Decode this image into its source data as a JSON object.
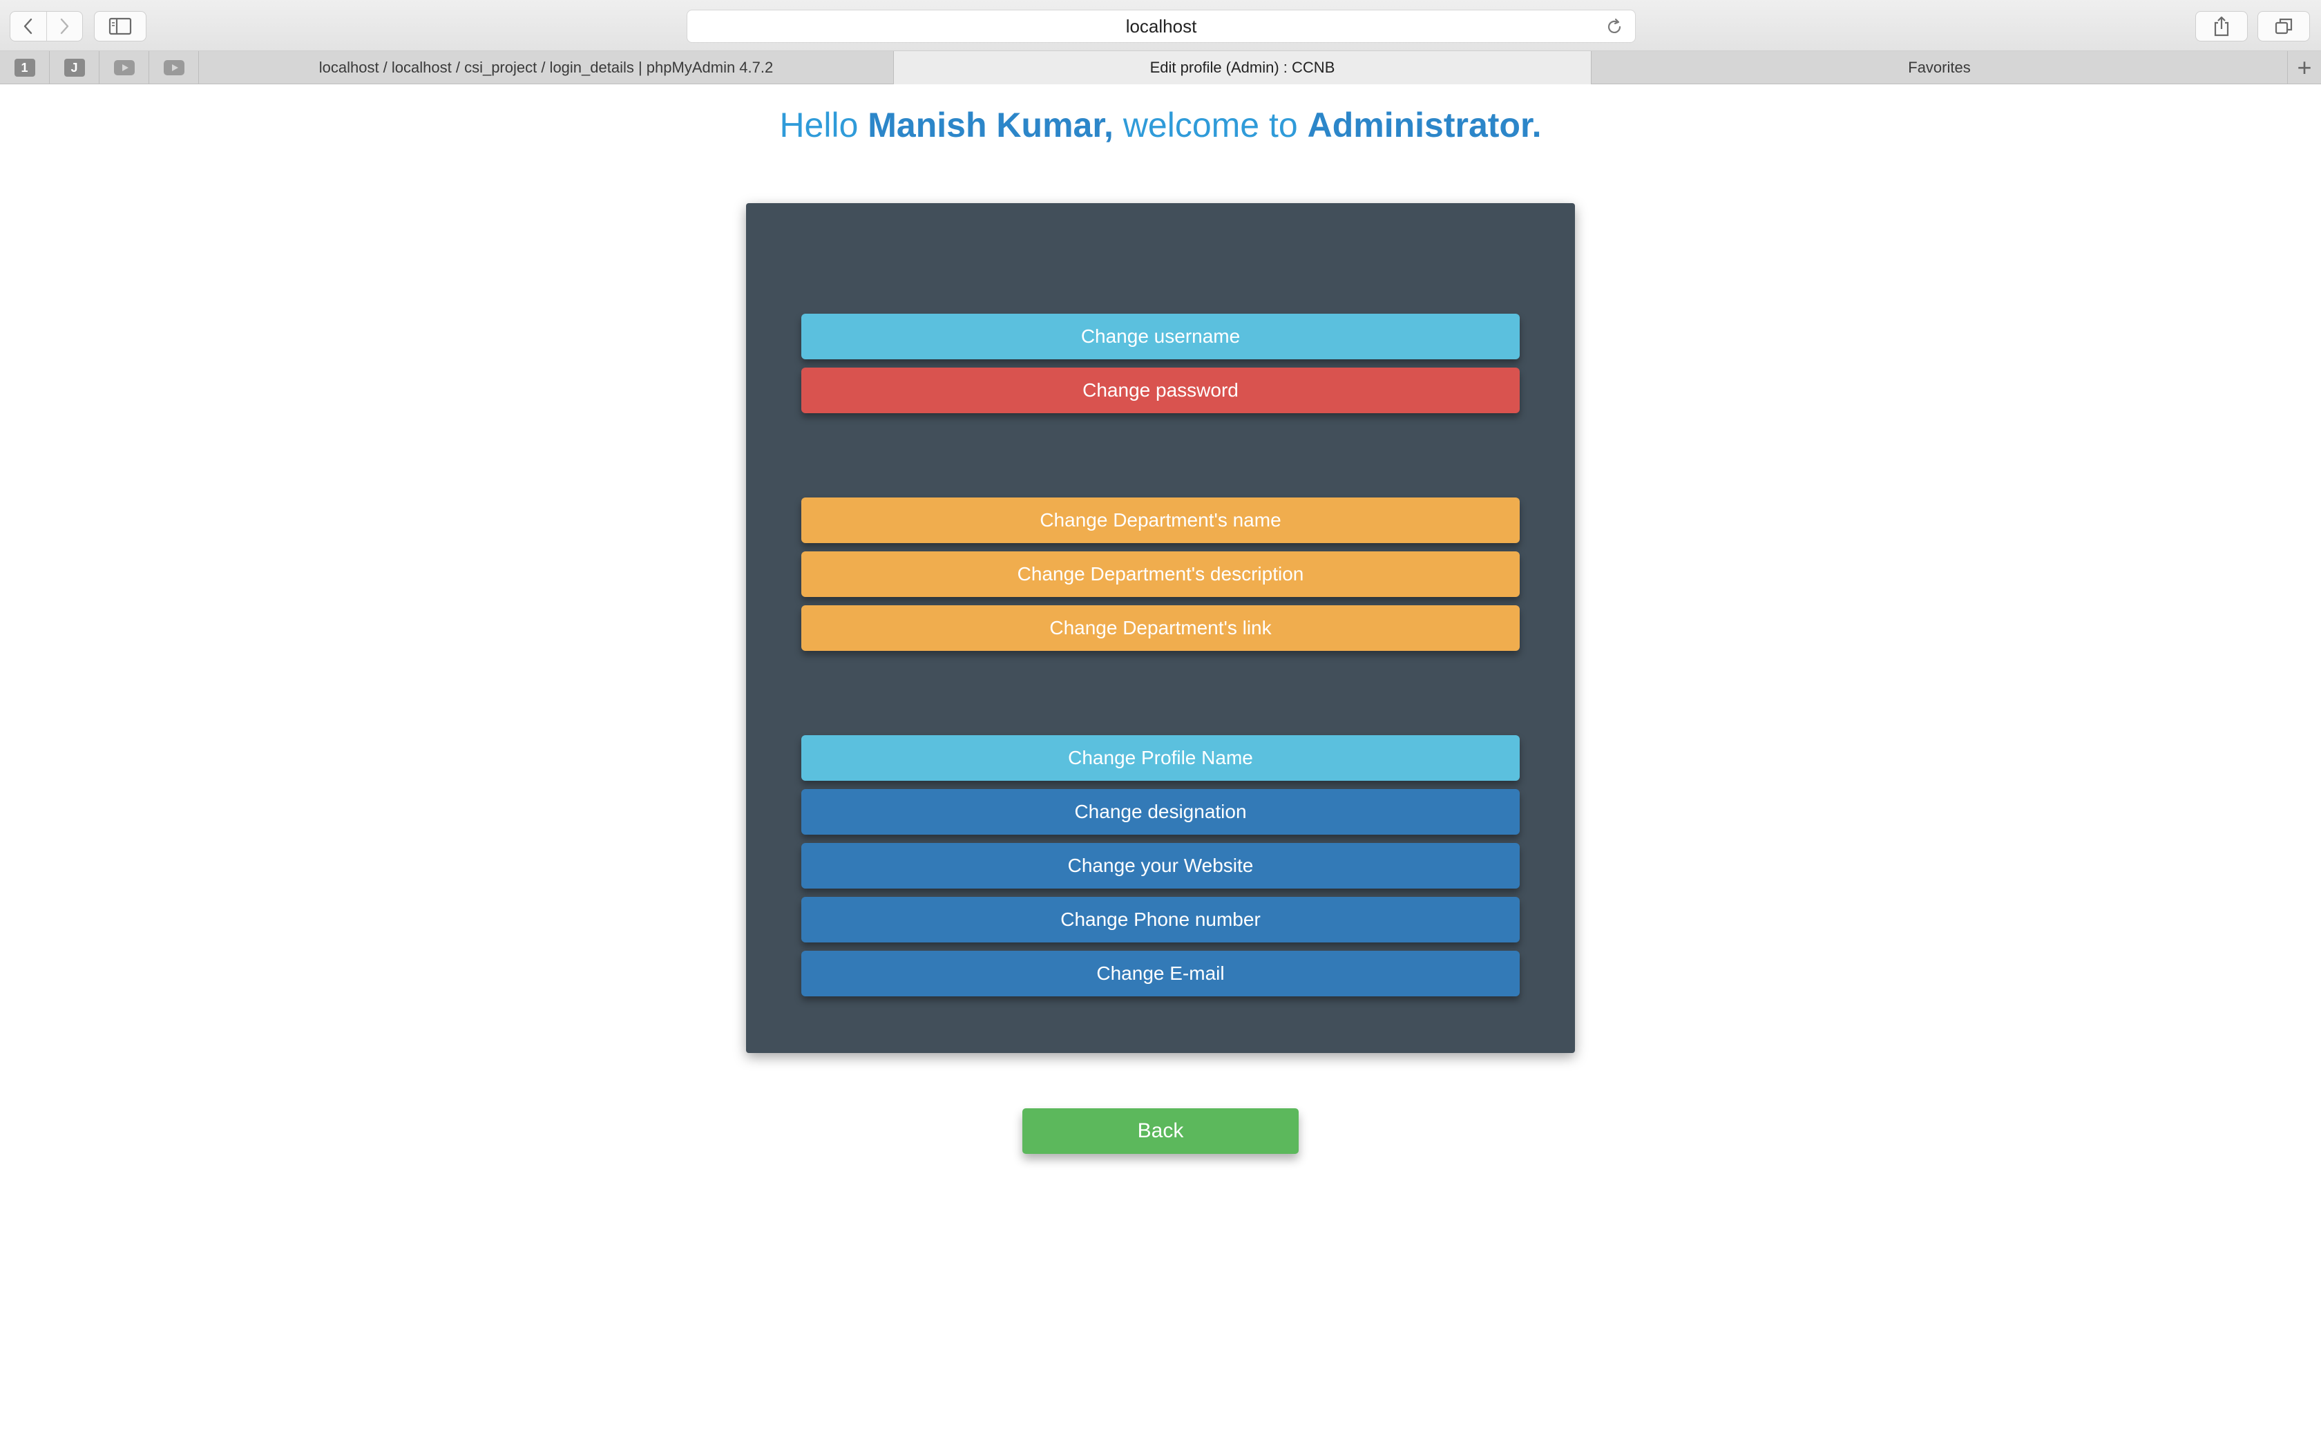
{
  "browser": {
    "address": "localhost",
    "tabs": [
      {
        "label": "localhost / localhost / csi_project / login_details | phpMyAdmin 4.7.2",
        "active": false
      },
      {
        "label": "Edit profile (Admin) : CCNB",
        "active": true
      },
      {
        "label": "Favorites",
        "active": false
      }
    ],
    "pinned": [
      "1",
      "J"
    ]
  },
  "header": {
    "hello": "Hello ",
    "name": "Manish Kumar,",
    "welcome": " welcome to ",
    "role": "Administrator."
  },
  "account_buttons": {
    "username": "Change username",
    "password": "Change password"
  },
  "department_buttons": {
    "name": "Change Department's name",
    "description": "Change Department's description",
    "link": "Change Department's link"
  },
  "profile_buttons": {
    "profile_name": "Change Profile Name",
    "designation": "Change designation",
    "website": "Change your Website",
    "phone": "Change Phone number",
    "email": "Change E-mail"
  },
  "back_label": "Back",
  "colors": {
    "info": "#5bc0de",
    "danger": "#d9534f",
    "warning": "#f0ad4e",
    "primary": "#337ab7",
    "success": "#5cb85c",
    "panel": "#424f5a",
    "heading": "#2f9bd9"
  }
}
